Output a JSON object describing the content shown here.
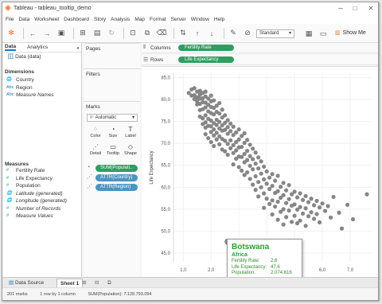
{
  "window": {
    "title": "Tableau - tableau_tooltip_demo",
    "min": "─",
    "max": "□",
    "close": "✕"
  },
  "menu": [
    "File",
    "Data",
    "Worksheet",
    "Dashboard",
    "Story",
    "Analysis",
    "Map",
    "Format",
    "Server",
    "Window",
    "Help"
  ],
  "toolbar": {
    "fit_value": "Standard",
    "show_me": "Show Me"
  },
  "data_pane": {
    "tabs": [
      "Data",
      "Analytics"
    ],
    "datasource": "Data (data)",
    "dimensions_title": "Dimensions",
    "dimensions": [
      {
        "icon": "🌐",
        "label": "Country",
        "italic": false
      },
      {
        "icon": "Abc",
        "label": "Region",
        "italic": false
      },
      {
        "icon": "Abc",
        "label": "Measure Names",
        "italic": true
      }
    ],
    "measures_title": "Measures",
    "measures": [
      {
        "icon": "#",
        "label": "Fertility Rate",
        "italic": false
      },
      {
        "icon": "#",
        "label": "Life Expectancy",
        "italic": false
      },
      {
        "icon": "#",
        "label": "Population",
        "italic": false
      },
      {
        "icon": "🌐",
        "label": "Latitude (generated)",
        "italic": true
      },
      {
        "icon": "🌐",
        "label": "Longitude (generated)",
        "italic": true
      },
      {
        "icon": "#",
        "label": "Number of Records",
        "italic": true
      },
      {
        "icon": "#",
        "label": "Measure Values",
        "italic": true
      }
    ]
  },
  "cards": {
    "pages": "Pages",
    "filters": "Filters",
    "marks": "Marks",
    "mark_type": "Automatic",
    "mark_buttons": [
      {
        "glyph": "⁘",
        "label": "Color"
      },
      {
        "glyph": "◔",
        "label": "Size"
      },
      {
        "glyph": "T",
        "label": "Label"
      },
      {
        "glyph": "⋰",
        "label": "Detail"
      },
      {
        "glyph": "▭",
        "label": "Tooltip"
      },
      {
        "glyph": "◇",
        "label": "Shape"
      }
    ],
    "mark_pills": [
      {
        "label": "SUM(Populati..",
        "color": "green"
      },
      {
        "label": "ATTR(Country)",
        "color": "blue"
      },
      {
        "label": "ATTR(Region)",
        "color": "blue"
      }
    ]
  },
  "shelves": {
    "columns_label": "Columns",
    "columns_pill": "Fertility Rate",
    "rows_label": "Rows",
    "rows_pill": "Life Expectancy"
  },
  "tooltip": {
    "country": "Botswana",
    "region": "Africa",
    "rows": [
      {
        "k": "Fertility Rate:",
        "v": "2,6"
      },
      {
        "k": "Life Expectancy:",
        "v": "47,6"
      },
      {
        "k": "Population:",
        "v": "2.074.616"
      }
    ]
  },
  "tabs": {
    "data_source": "Data Source",
    "sheet": "Sheet 1"
  },
  "status": {
    "marks": "201 marks",
    "rowscols": "1 row by 1 column",
    "sum": "SUM(Population): 7.128.793.094"
  },
  "chart_data": {
    "type": "scatter",
    "xlabel": "",
    "ylabel": "Life Expectancy",
    "xticks": [
      "1,0",
      "2,0",
      "3,0",
      "4,0",
      "5,0",
      "6,0",
      "7,0"
    ],
    "yticks": [
      "45,0",
      "50,0",
      "55,0",
      "60,0",
      "65,0",
      "70,0",
      "75,0",
      "80,0",
      "85,0"
    ],
    "xlim": [
      0.65,
      7.8
    ],
    "ylim": [
      43,
      86
    ],
    "grid": true,
    "color": "#7f7f7f",
    "highlight": {
      "x": 2.6,
      "y": 47.6
    },
    "points": [
      [
        1.2,
        81.5
      ],
      [
        1.3,
        82.3
      ],
      [
        1.3,
        80.9
      ],
      [
        1.4,
        81.0
      ],
      [
        1.4,
        80.1
      ],
      [
        1.4,
        82.6
      ],
      [
        1.5,
        81.8
      ],
      [
        1.5,
        80.5
      ],
      [
        1.5,
        79.6
      ],
      [
        1.5,
        78.9
      ],
      [
        1.6,
        82.0
      ],
      [
        1.6,
        81.1
      ],
      [
        1.6,
        80.2
      ],
      [
        1.6,
        79.0
      ],
      [
        1.6,
        77.6
      ],
      [
        1.6,
        76.1
      ],
      [
        1.7,
        81.5
      ],
      [
        1.7,
        80.3
      ],
      [
        1.7,
        79.4
      ],
      [
        1.7,
        77.8
      ],
      [
        1.7,
        75.7
      ],
      [
        1.7,
        74.4
      ],
      [
        1.8,
        81.8
      ],
      [
        1.8,
        80.7
      ],
      [
        1.8,
        79.3
      ],
      [
        1.8,
        78.2
      ],
      [
        1.8,
        76.4
      ],
      [
        1.8,
        74.8
      ],
      [
        1.8,
        73.6
      ],
      [
        1.8,
        72.1
      ],
      [
        1.9,
        80.2
      ],
      [
        1.9,
        78.8
      ],
      [
        1.9,
        77.3
      ],
      [
        1.9,
        75.6
      ],
      [
        1.9,
        74.0
      ],
      [
        1.9,
        71.2
      ],
      [
        2.0,
        80.9
      ],
      [
        2.0,
        79.6
      ],
      [
        2.0,
        78.3
      ],
      [
        2.0,
        76.9
      ],
      [
        2.0,
        75.2
      ],
      [
        2.0,
        73.9
      ],
      [
        2.0,
        72.6
      ],
      [
        2.0,
        70.3
      ],
      [
        2.1,
        79.8
      ],
      [
        2.1,
        78.1
      ],
      [
        2.1,
        76.6
      ],
      [
        2.1,
        74.6
      ],
      [
        2.1,
        73.2
      ],
      [
        2.1,
        71.8
      ],
      [
        2.1,
        69.4
      ],
      [
        2.2,
        78.6
      ],
      [
        2.2,
        77.2
      ],
      [
        2.2,
        75.4
      ],
      [
        2.2,
        74.2
      ],
      [
        2.2,
        72.4
      ],
      [
        2.2,
        70.9
      ],
      [
        2.3,
        79.2
      ],
      [
        2.3,
        76.8
      ],
      [
        2.3,
        74.9
      ],
      [
        2.3,
        73.4
      ],
      [
        2.3,
        71.6
      ],
      [
        2.3,
        69.8
      ],
      [
        2.4,
        77.7
      ],
      [
        2.4,
        75.9
      ],
      [
        2.4,
        74.1
      ],
      [
        2.4,
        72.9
      ],
      [
        2.4,
        71.0
      ],
      [
        2.4,
        68.6
      ],
      [
        2.5,
        76.4
      ],
      [
        2.5,
        74.7
      ],
      [
        2.5,
        73.1
      ],
      [
        2.5,
        70.6
      ],
      [
        2.5,
        68.2
      ],
      [
        2.6,
        75.3
      ],
      [
        2.6,
        73.7
      ],
      [
        2.6,
        72.2
      ],
      [
        2.6,
        69.9
      ],
      [
        2.6,
        67.4
      ],
      [
        2.6,
        47.6
      ],
      [
        2.7,
        74.5
      ],
      [
        2.7,
        72.8
      ],
      [
        2.7,
        70.7
      ],
      [
        2.7,
        68.9
      ],
      [
        2.8,
        73.8
      ],
      [
        2.8,
        71.9
      ],
      [
        2.8,
        69.6
      ],
      [
        2.8,
        67.8
      ],
      [
        2.8,
        65.2
      ],
      [
        2.9,
        72.5
      ],
      [
        2.9,
        70.3
      ],
      [
        2.9,
        68.4
      ],
      [
        2.9,
        66.5
      ],
      [
        3.0,
        73.2
      ],
      [
        3.0,
        70.9
      ],
      [
        3.0,
        69.1
      ],
      [
        3.0,
        67.0
      ],
      [
        3.0,
        64.6
      ],
      [
        3.1,
        71.7
      ],
      [
        3.1,
        69.2
      ],
      [
        3.1,
        66.9
      ],
      [
        3.1,
        63.8
      ],
      [
        3.2,
        72.3
      ],
      [
        3.2,
        70.1
      ],
      [
        3.2,
        67.6
      ],
      [
        3.2,
        65.7
      ],
      [
        3.2,
        62.8
      ],
      [
        3.3,
        70.8
      ],
      [
        3.3,
        68.3
      ],
      [
        3.3,
        66.2
      ],
      [
        3.3,
        63.4
      ],
      [
        3.4,
        69.7
      ],
      [
        3.4,
        67.1
      ],
      [
        3.4,
        64.9
      ],
      [
        3.4,
        61.9
      ],
      [
        3.5,
        68.8
      ],
      [
        3.5,
        66.4
      ],
      [
        3.5,
        64.1
      ],
      [
        3.5,
        60.6
      ],
      [
        3.6,
        67.9
      ],
      [
        3.6,
        65.4
      ],
      [
        3.6,
        62.5
      ],
      [
        3.6,
        59.4
      ],
      [
        3.7,
        66.8
      ],
      [
        3.7,
        64.3
      ],
      [
        3.7,
        61.2
      ],
      [
        3.7,
        57.9
      ],
      [
        3.8,
        65.9
      ],
      [
        3.8,
        63.1
      ],
      [
        3.8,
        60.0
      ],
      [
        3.9,
        64.7
      ],
      [
        3.9,
        61.8
      ],
      [
        3.9,
        58.6
      ],
      [
        3.9,
        55.3
      ],
      [
        4.0,
        63.6
      ],
      [
        4.0,
        60.8
      ],
      [
        4.0,
        57.4
      ],
      [
        4.1,
        62.2
      ],
      [
        4.1,
        59.6
      ],
      [
        4.1,
        56.2
      ],
      [
        4.2,
        63.0
      ],
      [
        4.2,
        60.3
      ],
      [
        4.2,
        57.0
      ],
      [
        4.2,
        53.8
      ],
      [
        4.3,
        61.5
      ],
      [
        4.3,
        58.7
      ],
      [
        4.3,
        55.6
      ],
      [
        4.4,
        62.6
      ],
      [
        4.4,
        59.1
      ],
      [
        4.4,
        56.7
      ],
      [
        4.4,
        52.6
      ],
      [
        4.5,
        60.1
      ],
      [
        4.5,
        57.6
      ],
      [
        4.5,
        54.4
      ],
      [
        4.6,
        61.0
      ],
      [
        4.6,
        58.2
      ],
      [
        4.6,
        55.0
      ],
      [
        4.6,
        51.5
      ],
      [
        4.7,
        59.3
      ],
      [
        4.7,
        56.4
      ],
      [
        4.7,
        53.2
      ],
      [
        4.8,
        60.5
      ],
      [
        4.8,
        57.3
      ],
      [
        4.8,
        54.7
      ],
      [
        4.9,
        58.4
      ],
      [
        4.9,
        55.8
      ],
      [
        4.9,
        52.1
      ],
      [
        5.0,
        59.0
      ],
      [
        5.0,
        56.1
      ],
      [
        5.0,
        53.5
      ],
      [
        5.1,
        57.7
      ],
      [
        5.1,
        54.9
      ],
      [
        5.1,
        51.8
      ],
      [
        5.2,
        58.6
      ],
      [
        5.2,
        55.5
      ],
      [
        5.2,
        52.4
      ],
      [
        5.3,
        57.1
      ],
      [
        5.3,
        54.0
      ],
      [
        5.4,
        58.0
      ],
      [
        5.4,
        55.2
      ],
      [
        5.4,
        51.2
      ],
      [
        5.5,
        56.6
      ],
      [
        5.5,
        53.4
      ],
      [
        5.6,
        57.4
      ],
      [
        5.6,
        54.3
      ],
      [
        5.7,
        55.9
      ],
      [
        5.7,
        52.8
      ],
      [
        5.8,
        56.9
      ],
      [
        5.8,
        53.9
      ],
      [
        5.9,
        55.4
      ],
      [
        5.9,
        52.0
      ],
      [
        6.0,
        56.3
      ],
      [
        6.1,
        54.6
      ],
      [
        6.2,
        55.7
      ],
      [
        6.3,
        53.1
      ],
      [
        6.4,
        57.8
      ],
      [
        6.6,
        54.2
      ],
      [
        6.9,
        56.0
      ],
      [
        7.1,
        52.7
      ],
      [
        7.6,
        58.4
      ],
      [
        6.7,
        50.6
      ]
    ]
  }
}
